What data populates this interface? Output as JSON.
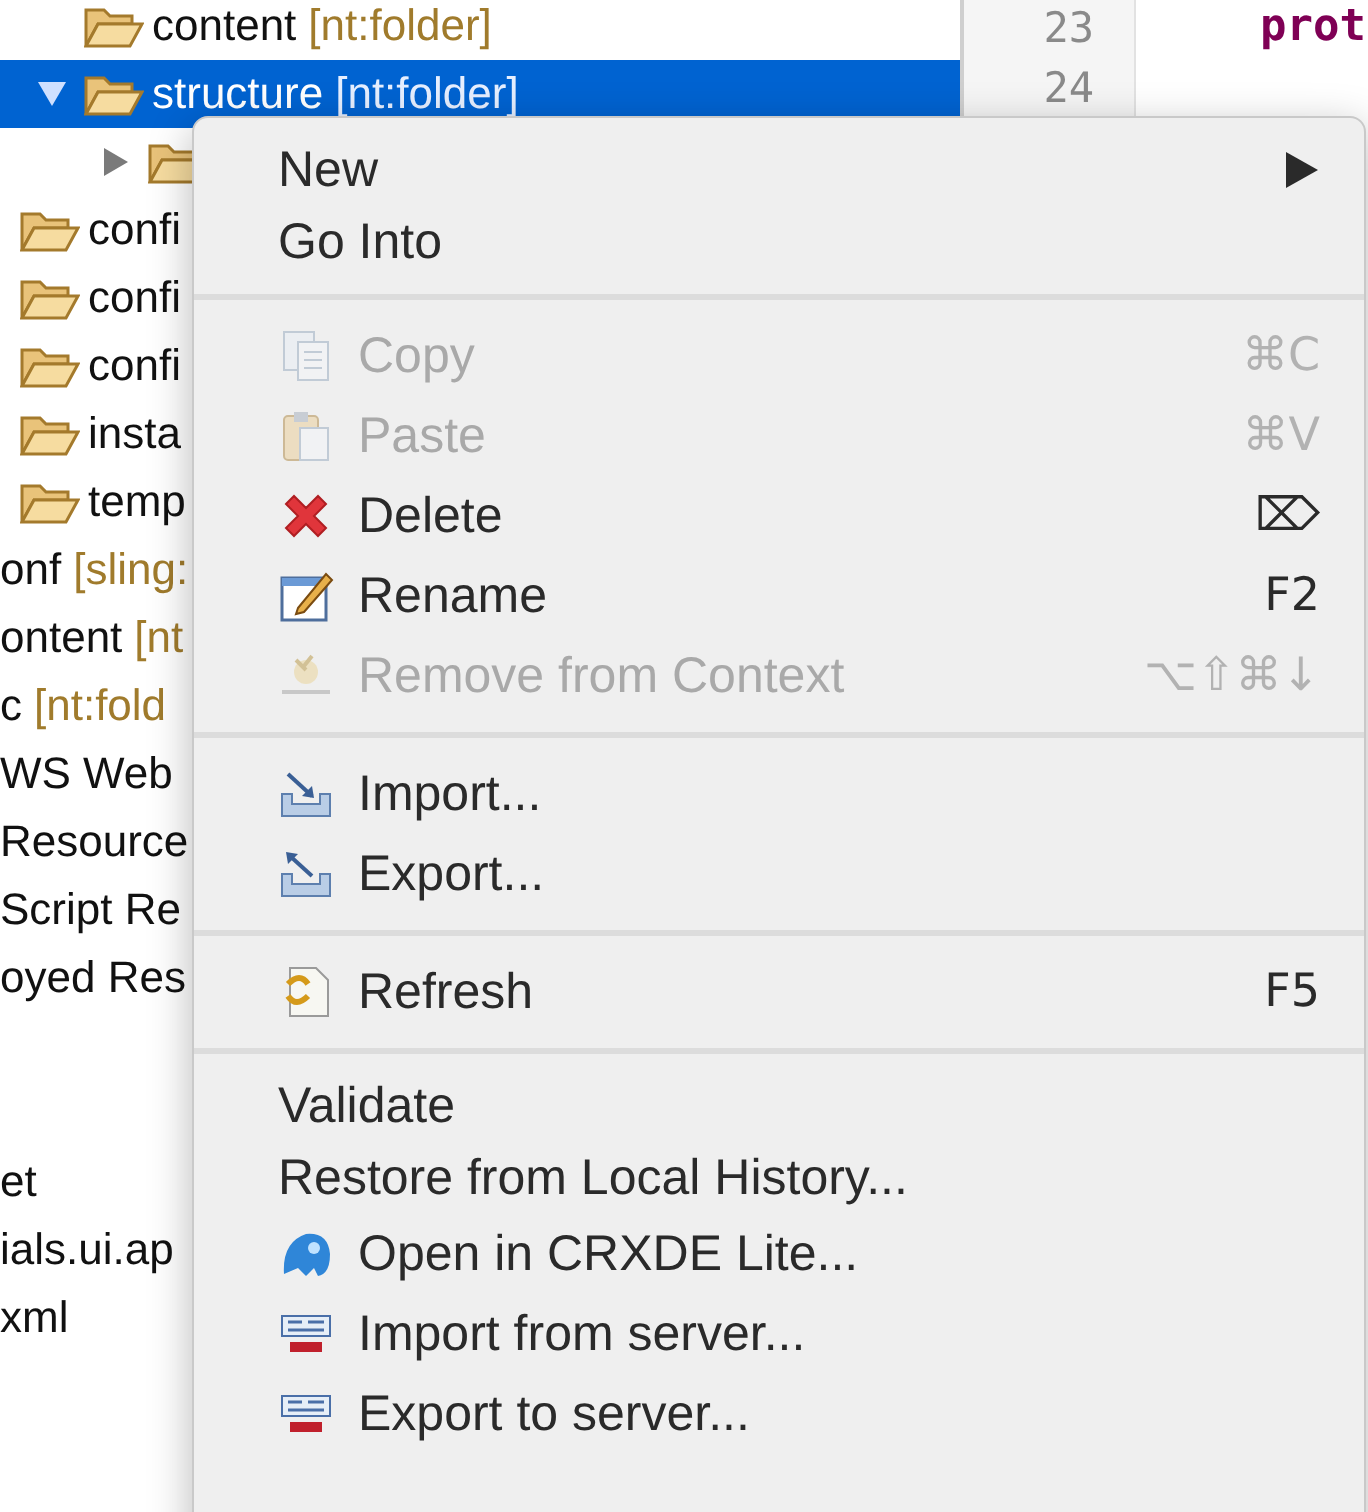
{
  "tree": [
    {
      "kind": "group",
      "children": [
        {
          "kind": "group",
          "children": [
            {
              "kind": "folder",
              "name": "content",
              "type": "[nt:folder]",
              "selected": false
            },
            {
              "kind": "folder",
              "name": "structure",
              "type": "[nt:folder]",
              "selected": true,
              "expanded": true,
              "children": [
                {
                  "kind": "folder",
                  "selected": false,
                  "expanded": false
                }
              ]
            }
          ]
        },
        {
          "kind": "folder",
          "name": "confi",
          "selected": false
        },
        {
          "kind": "folder",
          "name": "confi",
          "selected": false
        },
        {
          "kind": "folder",
          "name": "confi",
          "selected": false
        },
        {
          "kind": "folder",
          "name": "insta",
          "selected": false
        },
        {
          "kind": "folder",
          "name": "temp",
          "selected": false
        }
      ]
    },
    {
      "kind": "item",
      "name": "onf",
      "type": "[sling:",
      "selected": false
    },
    {
      "kind": "item",
      "name": "ontent",
      "type": "[nt",
      "selected": false
    },
    {
      "kind": "item",
      "name": "c",
      "type": "[nt:fold",
      "selected": false
    },
    {
      "kind": "item",
      "name": "WS Web",
      "selected": false
    },
    {
      "kind": "item",
      "name": " Resource",
      "selected": false
    },
    {
      "kind": "item",
      "name": "Script Re",
      "selected": false
    },
    {
      "kind": "item",
      "name": "oyed Res",
      "selected": false
    },
    {
      "kind": "blank",
      "selected": false
    },
    {
      "kind": "blank",
      "selected": false
    },
    {
      "kind": "item",
      "name": "et",
      "selected": false
    },
    {
      "kind": "item",
      "name": "ials.ui.ap",
      "selected": false
    },
    {
      "kind": "item",
      "name": "xml",
      "selected": false
    }
  ],
  "editor": {
    "lines": [
      {
        "number": "23",
        "code": "prot"
      },
      {
        "number": "24"
      }
    ]
  },
  "menu": {
    "sections": [
      {
        "items": [
          {
            "label": "New",
            "disabled": false,
            "submenu": true
          },
          {
            "label": "Go Into",
            "disabled": false
          }
        ]
      },
      {
        "items": [
          {
            "label": "Copy",
            "shortcut": "⌘C",
            "disabled": true
          },
          {
            "label": "Paste",
            "shortcut": "⌘V",
            "disabled": true
          },
          {
            "label": "Delete",
            "shortcut": "⌦",
            "disabled": false
          },
          {
            "label": "Rename",
            "shortcut": "F2",
            "disabled": false
          },
          {
            "label": "Remove from Context",
            "shortcut": "⌥⇧⌘↓",
            "disabled": true
          }
        ]
      },
      {
        "items": [
          {
            "label": "Import...",
            "disabled": false
          },
          {
            "label": "Export...",
            "disabled": false
          }
        ]
      },
      {
        "items": [
          {
            "label": "Refresh",
            "shortcut": "F5",
            "disabled": false
          }
        ]
      },
      {
        "items": [
          {
            "label": "Validate",
            "disabled": false
          },
          {
            "label": "Restore from Local History...",
            "disabled": false
          },
          {
            "label": "Open in CRXDE Lite...",
            "disabled": false
          },
          {
            "label": "Import from server...",
            "disabled": false
          },
          {
            "label": "Export to server...",
            "disabled": false
          }
        ]
      }
    ]
  }
}
